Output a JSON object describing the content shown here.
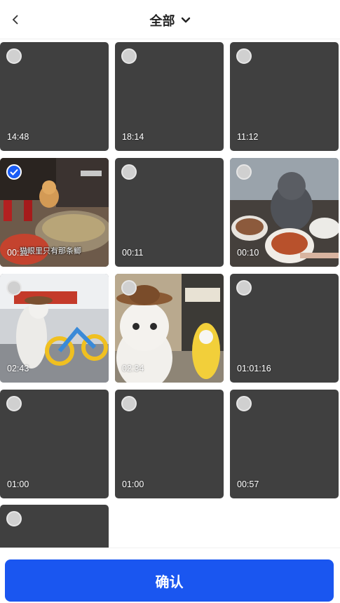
{
  "header": {
    "title": "全部",
    "back_icon": "chevron-left-icon",
    "dropdown_icon": "chevron-down-icon"
  },
  "colors": {
    "accent": "#1a56f0",
    "tile_bg": "#404040",
    "check": "#1a5cf5"
  },
  "videos": [
    {
      "duration": "14:48",
      "selected": false
    },
    {
      "duration": "18:14",
      "selected": false
    },
    {
      "duration": "11:12",
      "selected": false
    },
    {
      "duration": "00:12",
      "selected": true,
      "caption": "猫眼里只有那条鲫"
    },
    {
      "duration": "00:11",
      "selected": false
    },
    {
      "duration": "00:10",
      "selected": false
    },
    {
      "duration": "02:43",
      "selected": false
    },
    {
      "duration": "02:34",
      "selected": false
    },
    {
      "duration": "01:01:16",
      "selected": false
    },
    {
      "duration": "01:00",
      "selected": false
    },
    {
      "duration": "01:00",
      "selected": false
    },
    {
      "duration": "00:57",
      "selected": false
    },
    {
      "duration": "",
      "selected": false
    }
  ],
  "footer": {
    "confirm_label": "确认"
  }
}
